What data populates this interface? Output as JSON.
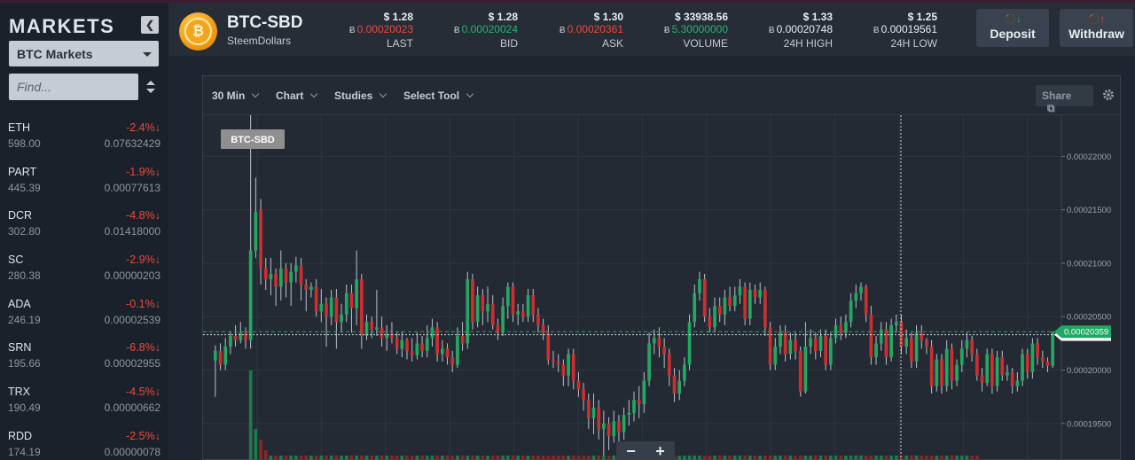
{
  "sidebar": {
    "title": "MARKETS",
    "collapse_icon": "chevron-left-icon",
    "market_select": "BTC Markets",
    "search_placeholder": "Find...",
    "coins": [
      {
        "symbol": "ETH",
        "usd": "598.00",
        "change": "-2.4%",
        "btc": "0.07632429"
      },
      {
        "symbol": "PART",
        "usd": "445.39",
        "change": "-1.9%",
        "btc": "0.00077613"
      },
      {
        "symbol": "DCR",
        "usd": "302.80",
        "change": "-4.8%",
        "btc": "0.01418000"
      },
      {
        "symbol": "SC",
        "usd": "280.38",
        "change": "-2.9%",
        "btc": "0.00000203"
      },
      {
        "symbol": "ADA",
        "usd": "246.19",
        "change": "-0.1%",
        "btc": "0.00002539"
      },
      {
        "symbol": "SRN",
        "usd": "195.66",
        "change": "-6.8%",
        "btc": "0.00002955"
      },
      {
        "symbol": "TRX",
        "usd": "190.49",
        "change": "-4.5%",
        "btc": "0.00000662"
      },
      {
        "symbol": "RDD",
        "usd": "174.19",
        "change": "-2.5%",
        "btc": "0.00000078"
      }
    ],
    "down_arrow": "↓"
  },
  "header": {
    "pair": "BTC-SBD",
    "pair_name": "SteemDollars",
    "btc_symbol": "Ƀ",
    "stats": [
      {
        "usd": "$ 1.28",
        "btc": "0.00020023",
        "label": "LAST",
        "color": "red"
      },
      {
        "usd": "$ 1.28",
        "btc": "0.00020024",
        "label": "BID",
        "color": "green"
      },
      {
        "usd": "$ 1.30",
        "btc": "0.00020361",
        "label": "ASK",
        "color": "red"
      },
      {
        "usd": "$ 33938.56",
        "btc": "5.30000000",
        "label": "VOLUME",
        "color": "green"
      },
      {
        "usd": "$ 1.33",
        "btc": "0.00020748",
        "label": "24H HIGH",
        "color": "white"
      },
      {
        "usd": "$ 1.25",
        "btc": "0.00019561",
        "label": "24H LOW",
        "color": "white"
      }
    ],
    "deposit_label": "Deposit",
    "withdraw_label": "Withdraw"
  },
  "chart": {
    "toolbar": {
      "interval": "30 Min",
      "chart": "Chart",
      "studies": "Studies",
      "select_tool": "Select Tool",
      "share": "Share"
    },
    "symbol_tag": "BTC-SBD",
    "zoom_out": "−",
    "zoom_in": "+",
    "colors": {
      "up": "#22a862",
      "down": "#cc2f2f",
      "volume_up": "#1d7a4a",
      "volume_down": "#8a2626",
      "grid": "#2e3641"
    }
  },
  "chart_data": {
    "type": "candlestick",
    "y_ticks": [
      "0.00022000",
      "0.00021500",
      "0.00021000",
      "0.00020500",
      "0.00020000",
      "0.00019500"
    ],
    "ylim": [
      0.0001915,
      0.00022385
    ],
    "crosshair_price": "0.00020331",
    "current_price": "0.00020359",
    "candles": [
      [
        0.0002009,
        0.0002018,
        0.0002023,
        0.0001975
      ],
      [
        0.0002018,
        0.0002005,
        0.0002025,
        0.0002
      ],
      [
        0.0002005,
        0.0002022,
        0.000203,
        0.0002
      ],
      [
        0.0002022,
        0.0002032,
        0.0002036,
        0.0002015
      ],
      [
        0.0002032,
        0.0002028,
        0.0002042,
        0.0002022
      ],
      [
        0.0002028,
        0.0002035,
        0.0002045,
        0.0002025
      ],
      [
        0.0002035,
        0.0002028,
        0.000204,
        0.000202
      ],
      [
        0.0002028,
        0.0002112,
        0.000235,
        0.000202
      ],
      [
        0.0002112,
        0.0002148,
        0.000218,
        0.0002105
      ],
      [
        0.000215,
        0.0002095,
        0.000216,
        0.000208
      ],
      [
        0.0002095,
        0.0002085,
        0.0002105,
        0.0002075
      ],
      [
        0.0002085,
        0.000209,
        0.0002105,
        0.000207
      ],
      [
        0.000209,
        0.0002078,
        0.0002095,
        0.000206
      ],
      [
        0.0002078,
        0.0002095,
        0.0002112,
        0.0002065
      ],
      [
        0.0002095,
        0.0002082,
        0.00021,
        0.0002068
      ],
      [
        0.0002082,
        0.0002092,
        0.00021,
        0.000206
      ],
      [
        0.0002092,
        0.0002098,
        0.0002106,
        0.0002082
      ],
      [
        0.0002098,
        0.000208,
        0.0002105,
        0.0002065
      ],
      [
        0.000208,
        0.0002075,
        0.0002085,
        0.0002055
      ],
      [
        0.0002075,
        0.0002078,
        0.0002082,
        0.0002068
      ],
      [
        0.0002078,
        0.0002055,
        0.0002085,
        0.000205
      ],
      [
        0.0002055,
        0.0002062,
        0.0002076,
        0.0002045
      ],
      [
        0.0002062,
        0.000205,
        0.0002068,
        0.0002022
      ],
      [
        0.000205,
        0.0002068,
        0.0002075,
        0.0002042
      ],
      [
        0.0002068,
        0.0002045,
        0.0002076,
        0.000202
      ],
      [
        0.0002045,
        0.0002052,
        0.0002062,
        0.0002035
      ],
      [
        0.0002052,
        0.0002072,
        0.000208,
        0.0002045
      ],
      [
        0.0002072,
        0.0002058,
        0.000208,
        0.0002035
      ],
      [
        0.0002058,
        0.0002085,
        0.0002112,
        0.0002042
      ],
      [
        0.0002085,
        0.0002032,
        0.000209,
        0.000202
      ],
      [
        0.0002032,
        0.0002045,
        0.0002052,
        0.0002028
      ],
      [
        0.0002045,
        0.0002038,
        0.000205,
        0.000203
      ],
      [
        0.0002038,
        0.000204,
        0.0002075,
        0.0002032
      ],
      [
        0.000204,
        0.000203,
        0.000205,
        0.0002022
      ],
      [
        0.000203,
        0.0002034,
        0.0002042,
        0.0002018
      ],
      [
        0.0002034,
        0.000203,
        0.0002045,
        0.0002025
      ],
      [
        0.000203,
        0.000202,
        0.0002035,
        0.0002015
      ],
      [
        0.000202,
        0.0002028,
        0.0002036,
        0.0002012
      ],
      [
        0.0002028,
        0.0002018,
        0.000203,
        0.000201
      ],
      [
        0.0002018,
        0.0002014,
        0.000203,
        0.0002008
      ],
      [
        0.0002014,
        0.0002025,
        0.0002035,
        0.000201
      ],
      [
        0.0002025,
        0.0002018,
        0.0002032,
        0.0002012
      ],
      [
        0.0002018,
        0.000203,
        0.0002042,
        0.0002012
      ],
      [
        0.000203,
        0.000204,
        0.0002048,
        0.0002022
      ],
      [
        0.000204,
        0.0002015,
        0.0002045,
        0.0002008
      ],
      [
        0.0002015,
        0.000202,
        0.0002028,
        0.0002008
      ],
      [
        0.000202,
        0.0002012,
        0.0002025,
        0.0002005
      ],
      [
        0.0002012,
        0.0002005,
        0.0002018,
        0.0001998
      ],
      [
        0.0002005,
        0.0002032,
        0.000204,
        0.0002002
      ],
      [
        0.0002032,
        0.0002025,
        0.0002045,
        0.0002018
      ],
      [
        0.0002025,
        0.0002085,
        0.0002092,
        0.000202
      ],
      [
        0.0002085,
        0.0002045,
        0.000209,
        0.0002038
      ],
      [
        0.0002045,
        0.000207,
        0.0002078,
        0.000204
      ],
      [
        0.000207,
        0.0002055,
        0.0002076,
        0.0002042
      ],
      [
        0.0002055,
        0.0002062,
        0.0002078,
        0.0002045
      ],
      [
        0.0002062,
        0.0002042,
        0.000207,
        0.0002038
      ],
      [
        0.0002042,
        0.0002035,
        0.0002048,
        0.0002028
      ],
      [
        0.0002035,
        0.000206,
        0.0002068,
        0.0002032
      ],
      [
        0.000206,
        0.0002078,
        0.0002082,
        0.0002048
      ],
      [
        0.0002078,
        0.0002052,
        0.0002082,
        0.0002045
      ],
      [
        0.0002052,
        0.0002055,
        0.0002062,
        0.0002042
      ],
      [
        0.0002055,
        0.000205,
        0.0002062,
        0.0002045
      ],
      [
        0.000205,
        0.000207,
        0.0002076,
        0.0002045
      ],
      [
        0.000207,
        0.0002052,
        0.0002076,
        0.0002045
      ],
      [
        0.0002052,
        0.0002042,
        0.0002058,
        0.0002035
      ],
      [
        0.0002042,
        0.0002035,
        0.0002048,
        0.0002028
      ],
      [
        0.0002035,
        0.000201,
        0.0002042,
        0.0002005
      ],
      [
        0.000201,
        0.0002008,
        0.0002018,
        0.0002002
      ],
      [
        0.0002008,
        0.0002005,
        0.0002015,
        0.0001998
      ],
      [
        0.0002005,
        0.0001995,
        0.000201,
        0.0001985
      ],
      [
        0.0001995,
        0.0002015,
        0.000202,
        0.0001985
      ],
      [
        0.0002015,
        0.000199,
        0.000202,
        0.0001982
      ],
      [
        0.000199,
        0.0001982,
        0.0001998,
        0.0001975
      ],
      [
        0.0001982,
        0.0001972,
        0.0001988,
        0.0001962
      ],
      [
        0.0001972,
        0.0001955,
        0.0001978,
        0.0001945
      ],
      [
        0.0001955,
        0.0001965,
        0.0001978,
        0.000194
      ],
      [
        0.0001965,
        0.0001945,
        0.0001972,
        0.0001935
      ],
      [
        0.0001945,
        0.000195,
        0.0001962,
        0.000192
      ],
      [
        0.000195,
        0.0001938,
        0.0001956,
        0.0001925
      ],
      [
        0.0001938,
        0.0001952,
        0.0001962,
        0.0001932
      ],
      [
        0.0001952,
        0.0001942,
        0.0001958,
        0.0001925
      ],
      [
        0.0001942,
        0.0001958,
        0.0001965,
        0.0001935
      ],
      [
        0.0001958,
        0.000196,
        0.0001972,
        0.0001948
      ],
      [
        0.000196,
        0.0001972,
        0.000198,
        0.0001952
      ],
      [
        0.0001972,
        0.0001968,
        0.0001985,
        0.0001955
      ],
      [
        0.0001968,
        0.000199,
        0.0001998,
        0.000196
      ],
      [
        0.000199,
        0.0002025,
        0.0002035,
        0.0001985
      ],
      [
        0.0002025,
        0.000203,
        0.0002038,
        0.0002015
      ],
      [
        0.000203,
        0.0002022,
        0.000204,
        0.0002012
      ],
      [
        0.0002022,
        0.0002015,
        0.000203,
        0.0002002
      ],
      [
        0.0002015,
        0.0001995,
        0.000202,
        0.0001985
      ],
      [
        0.0001995,
        0.0001978,
        0.0002002,
        0.000197
      ],
      [
        0.0001978,
        0.000199,
        0.0002,
        0.0001972
      ],
      [
        0.000199,
        0.0002005,
        0.0002012,
        0.0001985
      ],
      [
        0.0002005,
        0.0002045,
        0.0002052,
        0.0002
      ],
      [
        0.0002045,
        0.0002072,
        0.000208,
        0.000204
      ],
      [
        0.0002072,
        0.0002085,
        0.0002092,
        0.0002065
      ],
      [
        0.0002085,
        0.000205,
        0.000209,
        0.0002045
      ],
      [
        0.000205,
        0.000204,
        0.0002058,
        0.0002035
      ],
      [
        0.000204,
        0.000206,
        0.0002068,
        0.0002035
      ],
      [
        0.000206,
        0.0002052,
        0.0002068,
        0.0002045
      ],
      [
        0.0002052,
        0.0002068,
        0.0002075,
        0.0002042
      ],
      [
        0.0002068,
        0.000206,
        0.0002078,
        0.0002055
      ],
      [
        0.000206,
        0.000207,
        0.0002078,
        0.0002055
      ],
      [
        0.000207,
        0.0002078,
        0.0002085,
        0.0002062
      ],
      [
        0.0002078,
        0.0002048,
        0.0002082,
        0.0002042
      ],
      [
        0.0002048,
        0.0002075,
        0.0002082,
        0.0002042
      ],
      [
        0.0002075,
        0.0002068,
        0.000208,
        0.0002062
      ],
      [
        0.0002068,
        0.0002075,
        0.0002082,
        0.0002062
      ],
      [
        0.0002075,
        0.000204,
        0.0002078,
        0.0002032
      ],
      [
        0.000204,
        0.0002005,
        0.0002045,
        0.0002
      ],
      [
        0.0002005,
        0.0002022,
        0.000203,
        0.0002
      ],
      [
        0.0002022,
        0.0002035,
        0.0002042,
        0.0002015
      ],
      [
        0.0002035,
        0.0002015,
        0.0002042,
        0.0002008
      ],
      [
        0.0002015,
        0.0002028,
        0.0002035,
        0.000201
      ],
      [
        0.0002028,
        0.0002018,
        0.0002035,
        0.000201
      ],
      [
        0.0002018,
        0.000198,
        0.0002022,
        0.0001975
      ],
      [
        0.000198,
        0.0002022,
        0.0002045,
        0.0001978
      ],
      [
        0.0002022,
        0.000203,
        0.0002038,
        0.0002015
      ],
      [
        0.000203,
        0.0002018,
        0.0002035,
        0.000201
      ],
      [
        0.0002018,
        0.0002032,
        0.0002038,
        0.0002012
      ],
      [
        0.0002032,
        0.0002005,
        0.0002038,
        0.0002
      ],
      [
        0.0002005,
        0.000203,
        0.0002035,
        0.0002
      ],
      [
        0.000203,
        0.0002042,
        0.0002048,
        0.0002025
      ],
      [
        0.0002042,
        0.0002035,
        0.000205,
        0.0002028
      ],
      [
        0.0002035,
        0.0002045,
        0.0002052,
        0.000203
      ],
      [
        0.0002045,
        0.0002065,
        0.0002072,
        0.000204
      ],
      [
        0.0002065,
        0.0002072,
        0.000208,
        0.0002058
      ],
      [
        0.0002072,
        0.0002078,
        0.0002082,
        0.0002065
      ],
      [
        0.0002078,
        0.0002052,
        0.000208,
        0.0002045
      ],
      [
        0.0002052,
        0.0002012,
        0.000206,
        0.0002005
      ],
      [
        0.0002012,
        0.0002025,
        0.0002032,
        0.0002005
      ],
      [
        0.0002025,
        0.0002038,
        0.0002045,
        0.0002018
      ],
      [
        0.0002038,
        0.0002012,
        0.0002045,
        0.0002005
      ],
      [
        0.0002012,
        0.0002042,
        0.0002048,
        0.0002008
      ],
      [
        0.0002042,
        0.0002045,
        0.0002052,
        0.0002035
      ],
      [
        0.0002045,
        0.0002022,
        0.0002052,
        0.0002015
      ],
      [
        0.0002022,
        0.000203,
        0.0002038,
        0.0002015
      ],
      [
        0.000203,
        0.0002008,
        0.0002035,
        0.0002002
      ],
      [
        0.0002008,
        0.0002035,
        0.0002042,
        0.0002002
      ],
      [
        0.0002035,
        0.0002028,
        0.0002042,
        0.000202
      ],
      [
        0.0002028,
        0.0002022,
        0.000203,
        0.0002015
      ],
      [
        0.0002022,
        0.0001985,
        0.0002028,
        0.0001978
      ],
      [
        0.0001985,
        0.000201,
        0.0002015,
        0.000198
      ],
      [
        0.000201,
        0.0001985,
        0.0002015,
        0.0001978
      ],
      [
        0.0001985,
        0.000202,
        0.0002028,
        0.000198
      ],
      [
        0.000202,
        0.000199,
        0.0002025,
        0.0001982
      ],
      [
        0.000199,
        0.0002005,
        0.000201,
        0.0001985
      ],
      [
        0.0002005,
        0.000202,
        0.0002028,
        0.0001998
      ],
      [
        0.000202,
        0.0002028,
        0.0002035,
        0.0002012
      ],
      [
        0.0002028,
        0.0002015,
        0.0002032,
        0.0002008
      ],
      [
        0.0002015,
        0.0001995,
        0.000202,
        0.000199
      ],
      [
        0.0001995,
        0.0001988,
        0.0002002,
        0.000198
      ],
      [
        0.0001988,
        0.0002015,
        0.000202,
        0.0001985
      ],
      [
        0.0002015,
        0.0001985,
        0.000202,
        0.0001978
      ],
      [
        0.0001985,
        0.0002012,
        0.0002018,
        0.000198
      ],
      [
        0.0002012,
        0.0001995,
        0.0002018,
        0.000199
      ],
      [
        0.0001995,
        0.0001998,
        0.0002005,
        0.000199
      ],
      [
        0.0001998,
        0.0001985,
        0.0002002,
        0.0001978
      ],
      [
        0.0001985,
        0.000199,
        0.0001998,
        0.000198
      ],
      [
        0.000199,
        0.0002015,
        0.000202,
        0.0001985
      ],
      [
        0.0002015,
        0.0001998,
        0.000202,
        0.0001992
      ],
      [
        0.0001998,
        0.0002025,
        0.000203,
        0.0001992
      ],
      [
        0.0002025,
        0.0002012,
        0.000203,
        0.0002005
      ],
      [
        0.0002012,
        0.0002008,
        0.0002018,
        0.0002002
      ],
      [
        0.0002008,
        0.0002004,
        0.0002012,
        0.0001998
      ],
      [
        0.0002004,
        0.0002036,
        0.0002036,
        0.0002002
      ]
    ],
    "volumes": [
      0,
      0,
      0,
      0,
      0,
      0,
      0,
      0.85,
      0.3,
      0.2,
      0.1,
      0.05,
      0.05,
      0.05,
      0.05,
      0.05,
      0.05,
      0.05,
      0.05,
      0.05,
      0.05,
      0.05,
      0.05,
      0.05,
      0.05,
      0.05,
      0.05,
      0.05,
      0.05,
      0.05,
      0.05,
      0.05,
      0.05,
      0.05,
      0.05,
      0.05,
      0.05,
      0.05,
      0.05,
      0.05,
      0.05,
      0.05,
      0.05,
      0.05,
      0.05,
      0.05,
      0.05,
      0.05,
      0.05,
      0.05,
      0.05,
      0.05,
      0.05,
      0.05,
      0.05,
      0.05,
      0.05,
      0.05,
      0.05,
      0.05,
      0.05,
      0.05,
      0.05,
      0.05,
      0.05,
      0.05,
      0.05,
      0.05,
      0.05,
      0.05,
      0.05,
      0.05,
      0.05,
      0.05,
      0.05,
      0.05,
      0.05,
      0.05,
      0.05,
      0.05,
      0.05,
      0.05,
      0.05,
      0.05,
      0.05,
      0.05,
      0.05,
      0.05,
      0.05,
      0.05,
      0.05,
      0.05,
      0.05,
      0.05,
      0.05,
      0.05,
      0.05,
      0.05,
      0.05,
      0.05,
      0.05,
      0.05,
      0.05,
      0.05,
      0.05,
      0.05,
      0.05,
      0.05,
      0.05,
      0.05,
      0.05,
      0.05,
      0.05,
      0.05,
      0.05,
      0.05,
      0.05,
      0.05,
      0.05,
      0.05,
      0.05,
      0.05,
      0.05,
      0.05,
      0.05,
      0.05,
      0.05,
      0.05,
      0.05,
      0.05,
      0.05,
      0.05,
      0.05,
      0.05,
      0.05,
      0.05,
      0.05,
      0.05,
      0.05,
      0.05,
      0.05,
      0.05,
      0.05,
      0.05,
      0.05,
      0.05,
      0.05,
      0.05,
      0.05,
      0.05,
      0.05,
      0.05
    ]
  }
}
